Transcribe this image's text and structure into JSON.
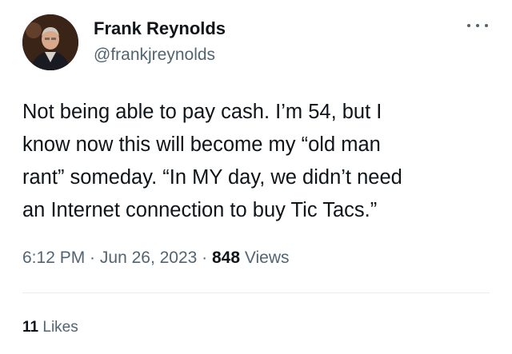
{
  "author": {
    "display_name": "Frank Reynolds",
    "handle": "@frankjreynolds"
  },
  "tweet": {
    "text": "Not being able to pay cash.  I’m 54, but I\nknow now this will become my “old man\nrant” someday.  “In MY day, we didn’t need\nan Internet connection to buy Tic Tacs.”"
  },
  "meta": {
    "time": "6:12 PM",
    "separator1": " · ",
    "date": "Jun 26, 2023",
    "separator2": " · ",
    "views_count": "848",
    "views_label": " Views"
  },
  "engagement": {
    "likes_count": "11",
    "likes_label": " Likes"
  },
  "icons": {
    "more": "more-horizontal-icon"
  },
  "colors": {
    "primary_text": "#0f1419",
    "secondary_text": "#536471",
    "divider": "#e6ecf0"
  }
}
